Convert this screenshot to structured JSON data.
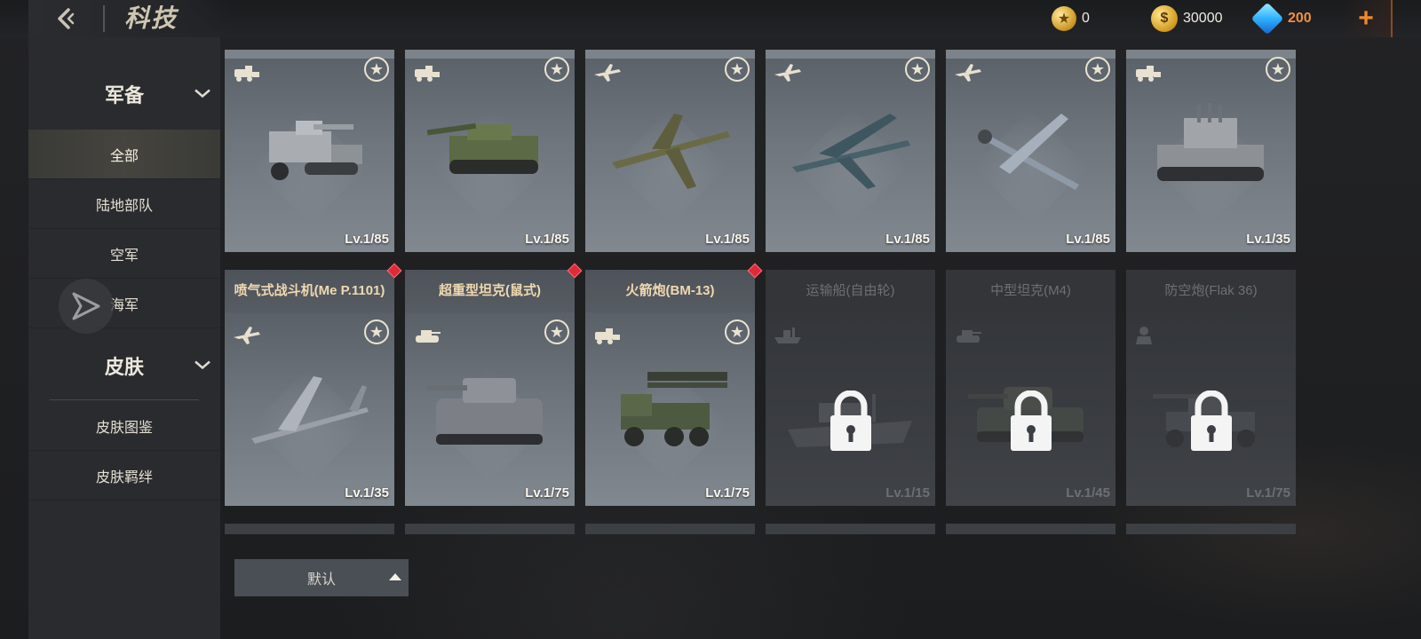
{
  "topbar": {
    "title": "科技",
    "currencies": [
      {
        "name": "star-coin",
        "value": "0"
      },
      {
        "name": "gold-coin",
        "value": "30000"
      },
      {
        "name": "diamond",
        "value": "200"
      }
    ],
    "plus_label": "+"
  },
  "sidebar": {
    "group1": {
      "label": "军备"
    },
    "items1": [
      {
        "label": "全部",
        "active": true
      },
      {
        "label": "陆地部队",
        "active": false
      },
      {
        "label": "空军",
        "active": false
      },
      {
        "label": "海军",
        "active": false
      }
    ],
    "group2": {
      "label": "皮肤"
    },
    "items2": [
      {
        "label": "皮肤图鉴"
      },
      {
        "label": "皮肤羁绊"
      }
    ]
  },
  "row1": [
    {
      "type": "vehicle",
      "lv": "Lv.1/85"
    },
    {
      "type": "vehicle",
      "lv": "Lv.1/85"
    },
    {
      "type": "plane",
      "lv": "Lv.1/85"
    },
    {
      "type": "plane",
      "lv": "Lv.1/85"
    },
    {
      "type": "plane",
      "lv": "Lv.1/85"
    },
    {
      "type": "vehicle",
      "lv": "Lv.1/35"
    }
  ],
  "row2": [
    {
      "name": "喷气式战斗机(Me P.1101)",
      "type": "plane",
      "lv": "Lv.1/35",
      "locked": false,
      "new": true
    },
    {
      "name": "超重型坦克(鼠式)",
      "type": "tank",
      "lv": "Lv.1/75",
      "locked": false,
      "new": true
    },
    {
      "name": "火箭炮(BM-13)",
      "type": "vehicle",
      "lv": "Lv.1/75",
      "locked": false,
      "new": true
    },
    {
      "name": "运输船(自由轮)",
      "type": "ship",
      "lv": "Lv.1/15",
      "locked": true,
      "new": false
    },
    {
      "name": "中型坦克(M4)",
      "type": "tank",
      "lv": "Lv.1/45",
      "locked": true,
      "new": false
    },
    {
      "name": "防空炮(Flak 36)",
      "type": "infantry",
      "lv": "Lv.1/75",
      "locked": true,
      "new": false
    }
  ],
  "sort": {
    "label": "默认"
  },
  "colors": {
    "accent_orange": "#f08a2a",
    "name_gold": "#efd9b0",
    "new_dot": "#e02a3a"
  }
}
